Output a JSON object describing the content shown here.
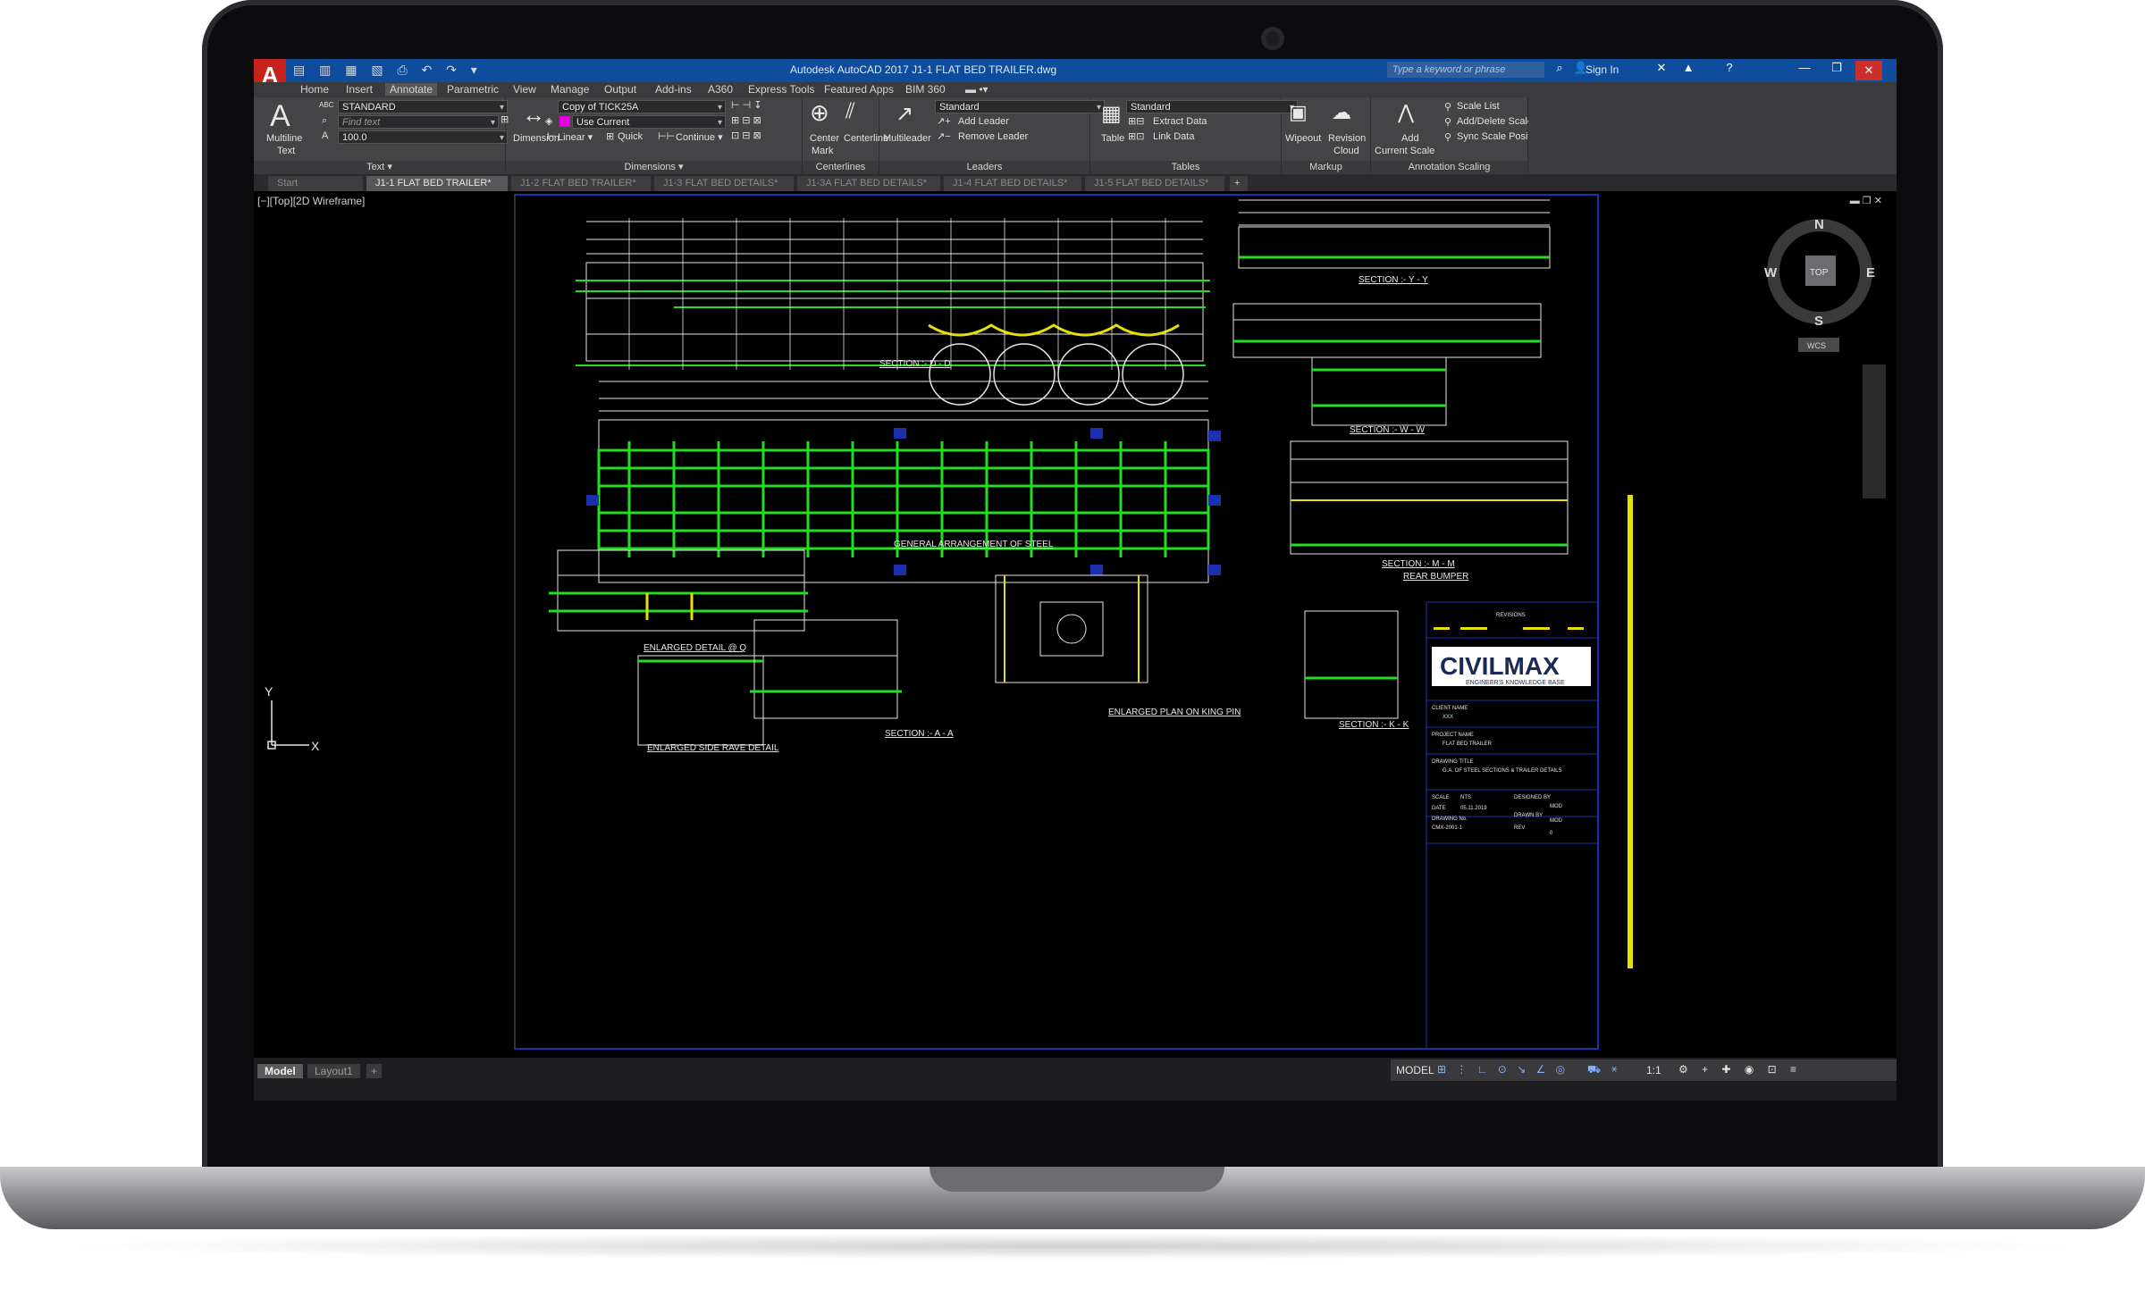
{
  "titlebar": {
    "app_letter": "A",
    "title": "Autodesk AutoCAD 2017    J1-1 FLAT BED TRAILER.dwg",
    "search_placeholder": "Type a keyword or phrase",
    "sign_in": "Sign In"
  },
  "ribbon_tabs": [
    "Home",
    "Insert",
    "Annotate",
    "Parametric",
    "View",
    "Manage",
    "Output",
    "Add-ins",
    "A360",
    "Express Tools",
    "Featured Apps",
    "BIM 360"
  ],
  "active_ribbon_tab": "Annotate",
  "ribbon": {
    "text_panel": {
      "multiline": "Multiline",
      "text": "Text",
      "style": "STANDARD",
      "find_placeholder": "Find text",
      "height": "100.0",
      "title": "Text ▾"
    },
    "dimensions_panel": {
      "dimension": "Dimension",
      "style": "Copy of TICK25A",
      "layer": "Use Current",
      "linear": "Linear ▾",
      "quick": "Quick",
      "continue": "Continue ▾",
      "title": "Dimensions ▾"
    },
    "centerlines_panel": {
      "center": "Center",
      "mark": "Mark",
      "centerline": "Centerline",
      "title": "Centerlines"
    },
    "leaders_panel": {
      "multileader": "Multileader",
      "style": "Standard",
      "add": "Add Leader",
      "remove": "Remove Leader",
      "title": "Leaders"
    },
    "tables_panel": {
      "table": "Table",
      "style": "Standard",
      "extract": "Extract Data",
      "link": "Link Data",
      "title": "Tables"
    },
    "markup_panel": {
      "wipeout": "Wipeout",
      "revision": "Revision",
      "cloud": "Cloud",
      "title": "Markup"
    },
    "scaling_panel": {
      "add": "Add",
      "current_scale": "Current Scale",
      "scale_list": "Scale List",
      "add_delete": "Add/Delete Scales",
      "sync": "Sync Scale Positions",
      "title": "Annotation Scaling"
    }
  },
  "doc_tabs": [
    "Start",
    "J1-1 FLAT BED TRAILER*",
    "J1-2 FLAT BED TRAILER*",
    "J1-3 FLAT BED DETAILS*",
    "J1-3A FLAT BED DETAILS*",
    "J1-4 FLAT BED DETAILS*",
    "J1-5 FLAT BED DETAILS*"
  ],
  "active_doc_tab": "J1-1 FLAT BED TRAILER*",
  "viewport_label": "[−][Top][2D Wireframe]",
  "viewcube": {
    "n": "N",
    "s": "S",
    "e": "E",
    "w": "W",
    "top": "TOP",
    "wcs": "WCS"
  },
  "ucs": {
    "x": "X",
    "y": "Y"
  },
  "drawing": {
    "labels": {
      "section_dd": "SECTION :- D - D",
      "section_yy": "SECTION :- Y - Y",
      "section_ww": "SECTION :- W - W",
      "general_arrangement": "GENERAL ARRANGEMENT OF STEEL",
      "section_mm": "SECTION :- M - M",
      "rear_bumper": "REAR BUMPER",
      "enlarged_q": "ENLARGED DETAIL @ Q",
      "enlarged_side": "ENLARGED SIDE RAVE DETAIL",
      "section_aa": "SECTION :- A - A",
      "king_pin": "ENLARGED PLAN ON KING PIN",
      "section_kk": "SECTION :- K - K"
    },
    "title_block": {
      "brand": "CIVILMAX",
      "tagline": "ENGINEER'S KNOWLEDGE BASE",
      "revisions": "REVISIONS",
      "client_label": "CLIENT NAME",
      "client": "XXX",
      "project_label": "PROJECT NAME",
      "project": "FLAT BED TRAILER",
      "drawing_title_label": "DRAWING TITLE",
      "drawing_title": "G.A. OF STEEL SECTIONS & TRAILER DETAILS",
      "scale_label": "SCALE",
      "scale": "NTS",
      "date_label": "DATE",
      "date": "05.11.2019",
      "drawing_no_label": "DRAWING No.",
      "drawing_no": "CMX-2001-1",
      "designed_label": "DESIGNED BY",
      "designed": "MOD",
      "drawn_label": "DRAWN BY",
      "drawn": "MOD",
      "rev_label": "REV",
      "rev": "0"
    }
  },
  "layout_tabs": [
    "Model",
    "Layout1"
  ],
  "status": {
    "model": "MODEL",
    "scale": "1:1"
  },
  "colors": {
    "titlebar": "#0e4d9c",
    "ribbon": "#444446",
    "cad_green": "#22dd22",
    "cad_yellow": "#e8e000",
    "cad_white": "#e6e6e6"
  }
}
